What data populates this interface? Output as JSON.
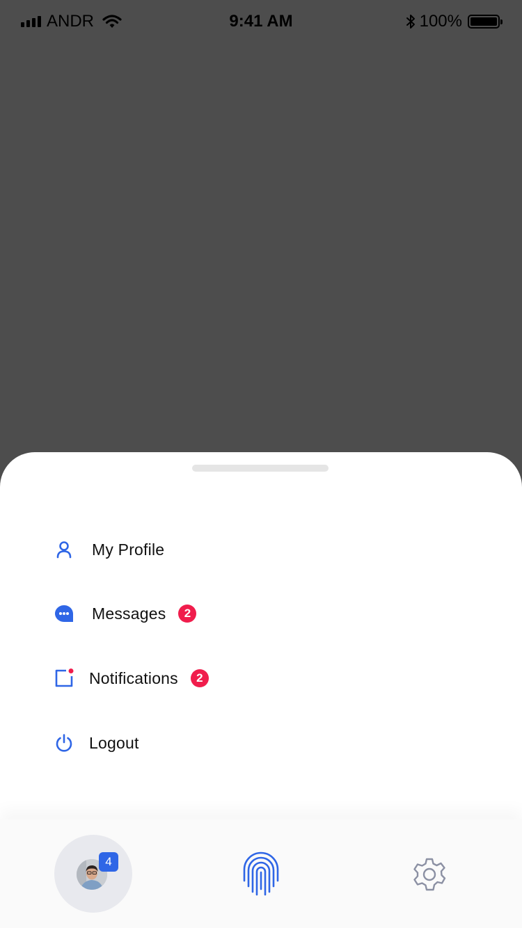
{
  "status_bar": {
    "carrier": "ANDR",
    "time": "9:41 AM",
    "battery_percent": "100%"
  },
  "menu": {
    "items": [
      {
        "label": "My Profile",
        "icon": "user-icon"
      },
      {
        "label": "Messages",
        "icon": "chat-bubble-icon",
        "badge": "2"
      },
      {
        "label": "Notifications",
        "icon": "notification-square-icon",
        "badge": "2"
      },
      {
        "label": "Logout",
        "icon": "power-icon"
      }
    ]
  },
  "tabbar": {
    "profile_badge": "4",
    "tabs": [
      "avatar",
      "fingerprint-icon",
      "gear-icon"
    ]
  },
  "colors": {
    "accent": "#2f66e6",
    "badge_red": "#f01d4c",
    "overlay": "#4d4d4d",
    "settings_gray": "#8b90a3"
  }
}
